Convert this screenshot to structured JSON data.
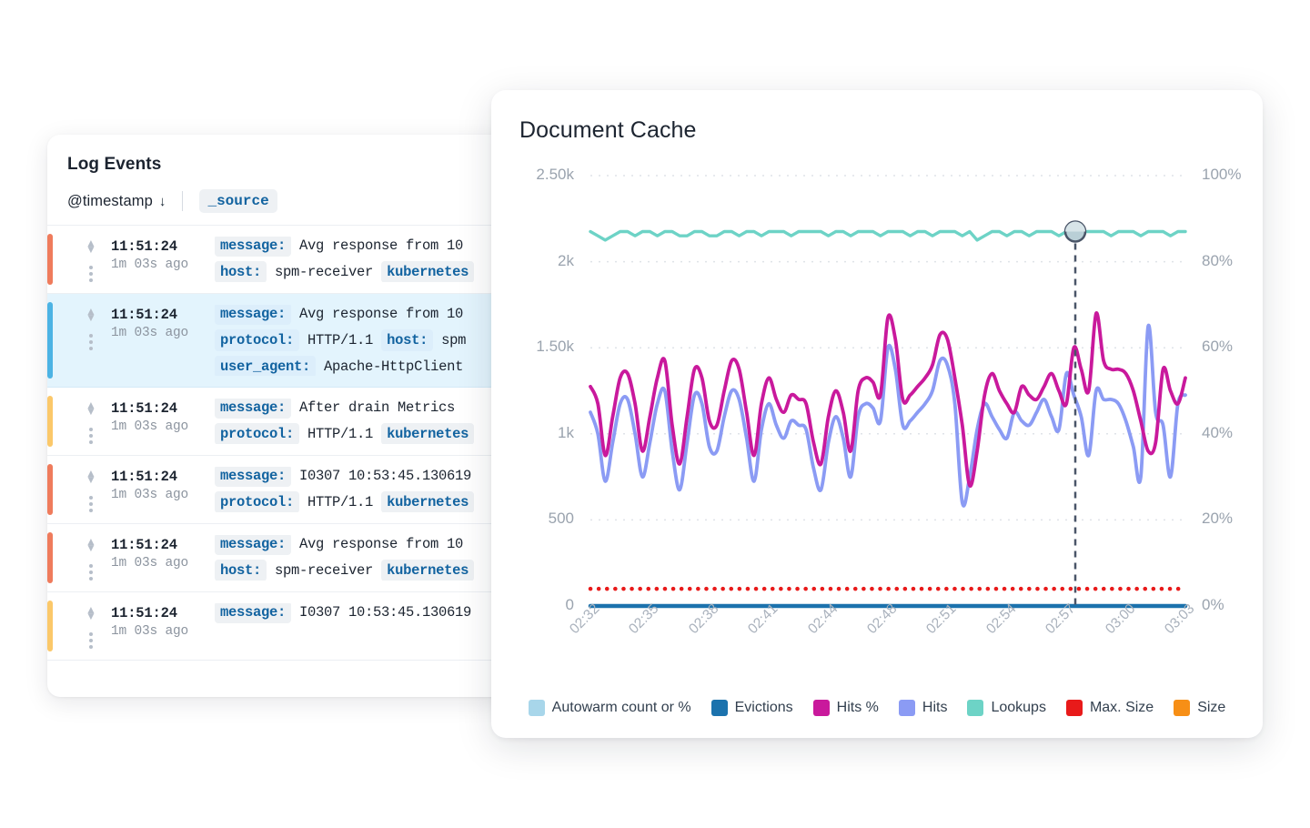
{
  "log_panel": {
    "title": "Log Events",
    "columns": {
      "timestamp": "@timestamp",
      "sort_icon": "↓",
      "source": "_source"
    },
    "rows": [
      {
        "accent": "#ef7b5c",
        "time": "11:51:24",
        "ago": "1m 03s ago",
        "selected": false,
        "lines": [
          {
            "key": "message:",
            "value": "Avg response from 10"
          },
          {
            "key": "host:",
            "value": "spm-receiver",
            "key2": "kubernetes"
          }
        ]
      },
      {
        "accent": "#4cb3e4",
        "time": "11:51:24",
        "ago": "1m 03s ago",
        "selected": true,
        "lines": [
          {
            "key": "message:",
            "value": "Avg response from 10"
          },
          {
            "key": "protocol:",
            "value": "HTTP/1.1",
            "key2": "host:",
            "value2": "spm"
          },
          {
            "key": "user_agent:",
            "value": "Apache-HttpClient"
          }
        ]
      },
      {
        "accent": "#fbc86a",
        "time": "11:51:24",
        "ago": "1m 03s ago",
        "selected": false,
        "lines": [
          {
            "key": "message:",
            "value": "After drain Metrics"
          },
          {
            "key": "protocol:",
            "value": "HTTP/1.1",
            "key2": "kubernetes"
          }
        ]
      },
      {
        "accent": "#ef7b5c",
        "time": "11:51:24",
        "ago": "1m 03s ago",
        "selected": false,
        "lines": [
          {
            "key": "message:",
            "value": "I0307 10:53:45.130619"
          },
          {
            "key": "protocol:",
            "value": "HTTP/1.1",
            "key2": "kubernetes"
          }
        ]
      },
      {
        "accent": "#ef7b5c",
        "time": "11:51:24",
        "ago": "1m 03s ago",
        "selected": false,
        "lines": [
          {
            "key": "message:",
            "value": "Avg response from 10"
          },
          {
            "key": "host:",
            "value": "spm-receiver",
            "key2": "kubernetes"
          }
        ]
      },
      {
        "accent": "#fbc86a",
        "time": "11:51:24",
        "ago": "1m 03s ago",
        "selected": false,
        "lines": [
          {
            "key": "message:",
            "value": "I0307 10:53:45.130619"
          }
        ]
      }
    ]
  },
  "chart_card": {
    "title": "Document Cache"
  },
  "chart_data": {
    "type": "line",
    "title": "Document Cache",
    "xlabel": "",
    "ylabel": "",
    "grid": true,
    "legend_position": "bottom",
    "x_ticks": [
      "02:32",
      "02:35",
      "02:38",
      "02:41",
      "02:44",
      "02:48",
      "02:51",
      "02:54",
      "02:57",
      "03:00",
      "03:03"
    ],
    "y_left_ticks": [
      "2.50k",
      "2k",
      "1.50k",
      "1k",
      "500",
      "0"
    ],
    "y_left_values": [
      2500,
      2000,
      1500,
      1000,
      500,
      0
    ],
    "y_left_lim": [
      0,
      2500
    ],
    "y_right_ticks": [
      "100%",
      "80%",
      "60%",
      "40%",
      "20%",
      "0%"
    ],
    "y_right_values": [
      100,
      80,
      60,
      40,
      20,
      0
    ],
    "y_right_lim": [
      0,
      100
    ],
    "cursor": {
      "label": "02:57",
      "x_fraction": 0.815
    },
    "series": [
      {
        "name": "Autowarm count or %",
        "color": "#a8d6ea",
        "axis": "right",
        "style": "solid",
        "visible": false,
        "values": []
      },
      {
        "name": "Evictions",
        "color": "#1b72ad",
        "axis": "left",
        "style": "solid",
        "values": [
          0,
          0,
          0,
          0,
          0,
          0,
          0,
          0,
          0,
          0,
          0,
          0,
          0,
          0,
          0,
          0,
          0,
          0,
          0,
          0,
          0,
          0,
          0,
          0,
          0,
          0,
          0,
          0,
          0,
          0,
          0,
          0,
          0,
          0,
          0,
          0,
          0,
          0,
          0,
          0,
          0,
          0,
          0,
          0,
          0,
          0,
          0,
          0,
          0,
          0,
          0,
          0,
          0,
          0,
          0,
          0,
          0,
          0,
          0,
          0,
          0,
          0,
          0,
          0,
          0,
          0,
          0,
          0,
          0,
          0,
          0,
          0,
          0,
          0,
          0,
          0,
          0,
          0,
          0,
          0
        ]
      },
      {
        "name": "Hits %",
        "color": "#c9199c",
        "axis": "right",
        "style": "solid",
        "values": [
          51,
          47,
          35,
          44,
          53,
          54,
          47,
          36,
          44,
          53,
          57,
          42,
          33,
          44,
          55,
          53,
          43,
          42,
          50,
          57,
          55,
          45,
          35,
          47,
          53,
          48,
          45,
          49,
          48,
          47,
          38,
          33,
          44,
          50,
          45,
          36,
          50,
          53,
          52,
          49,
          67,
          62,
          48,
          49,
          51,
          53,
          56,
          63,
          62,
          53,
          42,
          28,
          36,
          49,
          54,
          50,
          47,
          45,
          51,
          49,
          48,
          51,
          54,
          50,
          47,
          60,
          55,
          50,
          68,
          57,
          55,
          55,
          54,
          50,
          43,
          36,
          38,
          55,
          50,
          47,
          53
        ]
      },
      {
        "name": "Hits",
        "color": "#8b9bf4",
        "axis": "right",
        "style": "solid",
        "values": [
          45,
          40,
          29,
          38,
          47,
          48,
          40,
          30,
          38,
          47,
          50,
          36,
          27,
          38,
          49,
          47,
          37,
          36,
          44,
          50,
          48,
          39,
          29,
          41,
          47,
          42,
          39,
          43,
          42,
          41,
          32,
          27,
          38,
          44,
          39,
          30,
          44,
          47,
          46,
          43,
          60,
          55,
          42,
          43,
          45,
          47,
          50,
          57,
          56,
          47,
          24,
          30,
          41,
          47,
          44,
          41,
          39,
          45,
          43,
          42,
          45,
          48,
          44,
          41,
          54,
          49,
          44,
          35,
          50,
          48,
          48,
          47,
          43,
          37,
          30,
          65,
          45,
          42,
          30,
          47,
          49
        ]
      },
      {
        "name": "Lookups",
        "color": "#6dd3c6",
        "axis": "right",
        "style": "solid",
        "values": [
          87,
          86,
          85,
          86,
          87,
          87,
          86,
          87,
          87,
          86,
          87,
          87,
          86,
          86,
          87,
          87,
          86,
          86,
          87,
          87,
          86,
          87,
          87,
          86,
          87,
          87,
          87,
          86,
          87,
          87,
          87,
          87,
          86,
          87,
          87,
          86,
          87,
          87,
          87,
          86,
          87,
          87,
          87,
          86,
          87,
          87,
          86,
          87,
          87,
          87,
          86,
          87,
          85,
          86,
          87,
          87,
          86,
          87,
          87,
          86,
          87,
          87,
          87,
          86,
          87,
          87,
          87,
          87,
          87,
          87,
          86,
          87,
          87,
          87,
          86,
          87,
          87,
          87,
          86,
          87,
          87
        ]
      },
      {
        "name": "Max. Size",
        "color": "#e81a1a",
        "axis": "right",
        "style": "dotted",
        "values": [
          4,
          4,
          4,
          4,
          4,
          4,
          4,
          4,
          4,
          4,
          4,
          4,
          4,
          4,
          4,
          4,
          4,
          4,
          4,
          4,
          4,
          4,
          4,
          4,
          4,
          4,
          4,
          4,
          4,
          4,
          4,
          4,
          4,
          4,
          4,
          4,
          4,
          4,
          4,
          4,
          4,
          4,
          4,
          4,
          4,
          4,
          4,
          4,
          4,
          4,
          4,
          4,
          4,
          4,
          4,
          4,
          4,
          4,
          4,
          4,
          4,
          4,
          4,
          4,
          4,
          4,
          4,
          4,
          4,
          4,
          4,
          4,
          4,
          4,
          4,
          4,
          4,
          4,
          4,
          4,
          4
        ]
      },
      {
        "name": "Size",
        "color": "#f78f16",
        "axis": "left",
        "style": "solid",
        "visible": false,
        "values": []
      }
    ],
    "legend": [
      {
        "label": "Autowarm count or %",
        "color": "#a8d6ea"
      },
      {
        "label": "Evictions",
        "color": "#1b72ad"
      },
      {
        "label": "Hits %",
        "color": "#c9199c"
      },
      {
        "label": "Hits",
        "color": "#8b9bf4"
      },
      {
        "label": "Lookups",
        "color": "#6dd3c6"
      },
      {
        "label": "Max. Size",
        "color": "#e81a1a"
      },
      {
        "label": "Size",
        "color": "#f78f16"
      }
    ]
  }
}
